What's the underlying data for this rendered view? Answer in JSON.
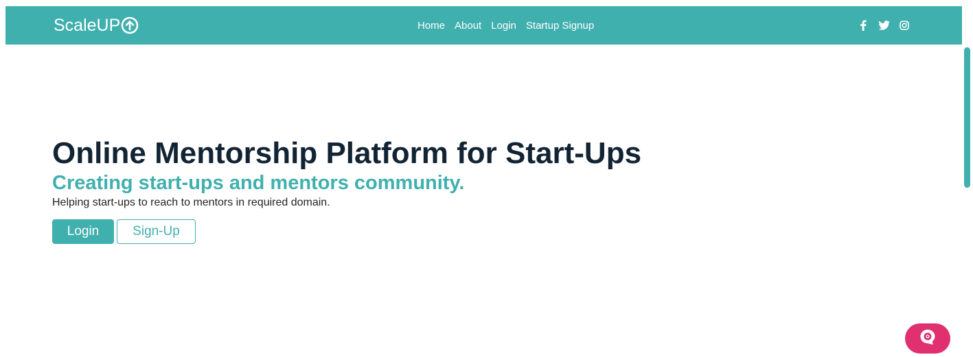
{
  "navbar": {
    "brand": "ScaleUP",
    "brand_icon": "arrow-up-circle-icon",
    "links": [
      {
        "label": "Home"
      },
      {
        "label": "About"
      },
      {
        "label": "Login"
      },
      {
        "label": "Startup Signup"
      }
    ],
    "socials": [
      {
        "icon": "facebook-icon"
      },
      {
        "icon": "twitter-icon"
      },
      {
        "icon": "instagram-icon"
      }
    ]
  },
  "hero": {
    "title": "Online Mentorship Platform for Start-Ups",
    "subtitle": "Creating start-ups and mentors community.",
    "text": "Helping start-ups to reach to mentors in required domain.",
    "login_label": "Login",
    "signup_label": "Sign-Up"
  },
  "chat_widget": {
    "icon": "chat-bot-icon"
  },
  "colors": {
    "accent": "#40b0ae",
    "heading": "#122434",
    "chat": "#e0306f"
  }
}
